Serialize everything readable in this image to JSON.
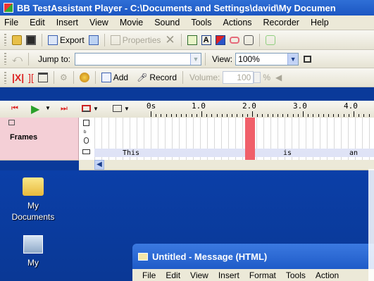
{
  "window": {
    "title": "BB TestAssistant Player - C:\\Documents and Settings\\david\\My Documen"
  },
  "menu": [
    "File",
    "Edit",
    "Insert",
    "View",
    "Movie",
    "Sound",
    "Tools",
    "Actions",
    "Recorder",
    "Help"
  ],
  "toolbar1": {
    "export_label": "Export",
    "properties_label": "Properties"
  },
  "toolbar2": {
    "jump_label": "Jump to:",
    "jump_value": "",
    "view_label": "View:",
    "view_value": "100%"
  },
  "toolbar3": {
    "add_label": "Add",
    "record_label": "Record",
    "volume_label": "Volume:",
    "volume_value": "100"
  },
  "timeline": {
    "ruler_labels": [
      "0s",
      "1.0",
      "2.0",
      "3.0",
      "4.0"
    ],
    "track_label": "Frames",
    "text_snippets": [
      "This",
      "is",
      "an"
    ]
  },
  "desktop": {
    "icons": [
      {
        "label": "My\nDocuments"
      },
      {
        "label": "My"
      }
    ]
  },
  "subwindow": {
    "title": "Untitled - Message (HTML)",
    "menu": [
      "File",
      "Edit",
      "View",
      "Insert",
      "Format",
      "Tools",
      "Action"
    ]
  },
  "colors": {
    "titlebar": "#1c56c2",
    "frames_bg": "#f4cfd6",
    "playhead": "#f0606a",
    "desktop": "#0a3a9a"
  }
}
